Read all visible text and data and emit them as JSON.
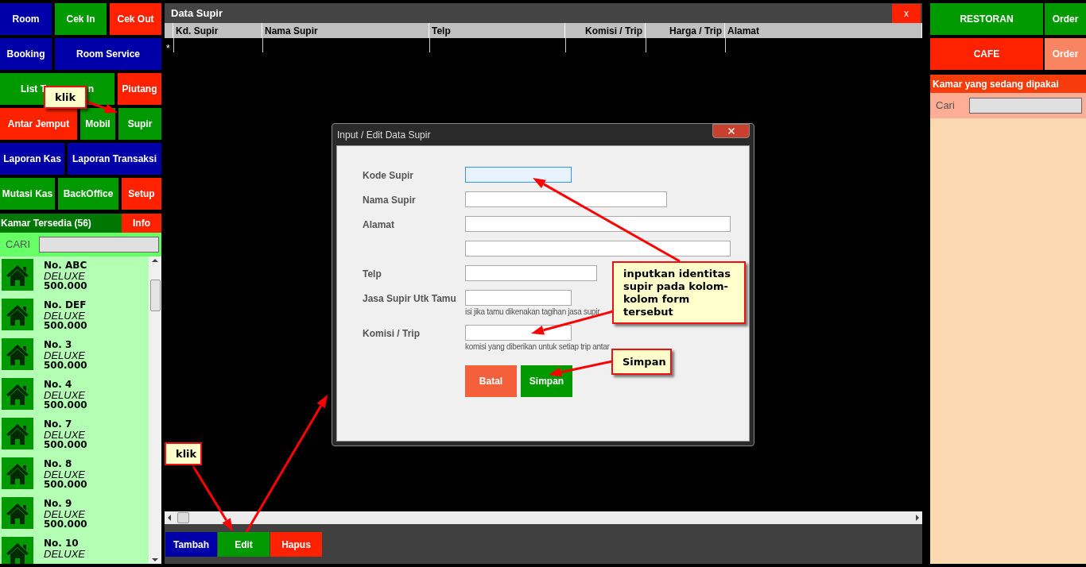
{
  "menu_rows": [
    [
      {
        "label": "Room",
        "color": "#0000a8"
      },
      {
        "label": "Cek In",
        "color": "#009900"
      },
      {
        "label": "Cek Out",
        "color": "#ff2200"
      }
    ],
    [
      {
        "label": "Booking",
        "color": "#0000a8"
      },
      {
        "label": "Room Service",
        "color": "#0000a8"
      }
    ],
    [
      {
        "label_parts": [
          "List T",
          "n"
        ],
        "color": "#009900"
      },
      {
        "label": "Piutang",
        "color": "#ff2200"
      }
    ],
    [
      {
        "label": "Antar Jemput",
        "color": "#ff2200"
      },
      {
        "label": "Mobil",
        "color": "#009900"
      },
      {
        "label": "Supir",
        "color": "#009900"
      }
    ],
    [
      {
        "label": "Laporan Kas",
        "color": "#0000a8"
      },
      {
        "label": "Laporan Transaksi",
        "color": "#0000a8"
      }
    ],
    [
      {
        "label": "Mutasi Kas",
        "color": "#009900"
      },
      {
        "label": "BackOffice",
        "color": "#009900"
      },
      {
        "label": "Setup",
        "color": "#ff2200"
      }
    ]
  ],
  "available_rooms": {
    "title": "Kamar Tersedia (56)",
    "info_button": "Info",
    "search_label": "CARI",
    "rooms": [
      {
        "name": "No. ABC",
        "type": "DELUXE",
        "price": "500.000"
      },
      {
        "name": "No. DEF",
        "type": "DELUXE",
        "price": "500.000"
      },
      {
        "name": "No. 3",
        "type": "DELUXE",
        "price": "500.000"
      },
      {
        "name": "No. 4",
        "type": "DELUXE",
        "price": "500.000"
      },
      {
        "name": "No. 7",
        "type": "DELUXE",
        "price": "500.000"
      },
      {
        "name": "No. 8",
        "type": "DELUXE",
        "price": "500.000"
      },
      {
        "name": "No. 9",
        "type": "DELUXE",
        "price": "500.000"
      },
      {
        "name": "No. 10",
        "type": "DELUXE"
      }
    ]
  },
  "main_window": {
    "title": "Data Supir",
    "close": "x",
    "table": {
      "columns": [
        "Kd. Supir",
        "Nama Supir",
        "Telp",
        "Komisi / Trip",
        "Harga / Trip",
        "Alamat"
      ],
      "new_row_marker": "*"
    },
    "buttons": [
      {
        "label": "Tambah",
        "color": "#0000a8"
      },
      {
        "label": "Edit",
        "color": "#009900"
      },
      {
        "label": "Hapus",
        "color": "#ff2200"
      }
    ]
  },
  "dialog": {
    "title": "Input / Edit Data Supir",
    "fields": [
      {
        "label": "Kode Supir",
        "focused": true
      },
      {
        "label": "Nama Supir",
        "focused": false
      },
      {
        "label": "Alamat",
        "focused": false
      },
      {
        "focused": false
      },
      {
        "label": "Telp",
        "focused": false
      },
      {
        "label": "Jasa Supir Utk Tamu",
        "focused": false,
        "hint": "isi jika tamu dikenakan tagihan jasa supir"
      },
      {
        "label": "Komisi / Trip",
        "focused": false,
        "hint": "komisi yang diberikan untuk setiap trip antar"
      }
    ],
    "buttons": [
      {
        "label": "Batal",
        "color": "#f5603c"
      },
      {
        "label": "Simpan",
        "color": "#009900"
      }
    ]
  },
  "right_panel": {
    "outlets": [
      {
        "label": "RESTORAN",
        "color": "#009900",
        "order": {
          "label": "Order",
          "color": "#009900"
        }
      },
      {
        "label": "CAFE",
        "color": "#ff2200",
        "order": {
          "label": "Order",
          "color": "#f88462"
        }
      }
    ],
    "occupied_title": "Kamar yang sedang dipakai",
    "search_label": "Cari"
  },
  "callouts": [
    {
      "text": "klik"
    },
    {
      "text": "inputkan identitas supir pada kolom-kolom form tersebut"
    },
    {
      "text": "Simpan"
    },
    {
      "text": "klik"
    }
  ]
}
